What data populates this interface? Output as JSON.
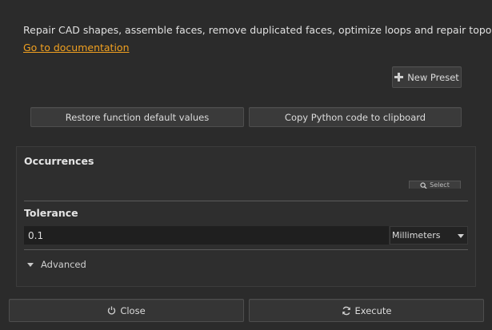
{
  "header": {
    "description": "Repair CAD shapes, assemble faces, remove duplicated faces, optimize loops and repair topology",
    "doc_link": "Go to documentation"
  },
  "toolbar": {
    "new_preset_label": "New Preset",
    "restore_label": "Restore function default values",
    "copy_label": "Copy Python code to clipboard"
  },
  "occurrences": {
    "title": "Occurrences",
    "select_label": "Select"
  },
  "tolerance": {
    "title": "Tolerance",
    "value": "0.1",
    "unit": "Millimeters"
  },
  "advanced": {
    "label": "Advanced"
  },
  "footer": {
    "close_label": "Close",
    "execute_label": "Execute"
  },
  "colors": {
    "background": "#2b2b2b",
    "link": "#f0a020",
    "button": "#3a3a3a"
  },
  "icons": {
    "new_preset": "plus-icon",
    "select": "search-icon",
    "close": "power-icon",
    "execute": "refresh-icon",
    "advanced": "triangle-down-icon",
    "unit": "chevron-down-icon"
  }
}
